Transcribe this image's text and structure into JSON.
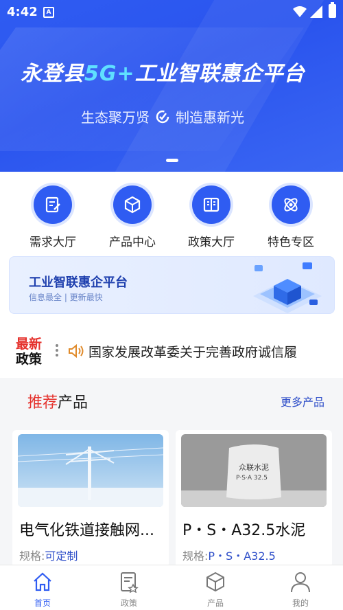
{
  "status": {
    "time": "4:42",
    "app_badge": "A"
  },
  "banner": {
    "title_pre": "永登县",
    "title_hl": "5G+",
    "title_post": "工业智联惠企平台",
    "subtitle_left": "生态聚万贤",
    "subtitle_right": "制造惠新光"
  },
  "grid": [
    {
      "label": "需求大厅",
      "icon": "edit-doc-icon"
    },
    {
      "label": "产品中心",
      "icon": "cube-icon"
    },
    {
      "label": "政策大厅",
      "icon": "book-icon"
    },
    {
      "label": "特色专区",
      "icon": "atom-icon"
    }
  ],
  "promo": {
    "title": "工业智联惠企平台",
    "subtitle": "信息最全 | 更新最快"
  },
  "news": {
    "badge_top": "最新",
    "badge_bottom": "政策",
    "text": "国家发展改革委关于完善政府诚信履"
  },
  "section": {
    "title_red": "推荐",
    "title_rest": "产品",
    "more": "更多产品"
  },
  "products": [
    {
      "name": "电气化铁道接触网...",
      "spec_label": "规格:",
      "spec_value": "可定制"
    },
    {
      "name": "P・S・A32.5水泥",
      "spec_label": "规格:",
      "spec_value": "P・S・A32.5",
      "bag_text1": "众联水泥",
      "bag_text2": "P·S·A 32.5"
    }
  ],
  "tabs": [
    {
      "label": "首页"
    },
    {
      "label": "政策"
    },
    {
      "label": "产品"
    },
    {
      "label": "我的"
    }
  ],
  "colors": {
    "brand": "#2f5cf2",
    "accent_red": "#e5322d",
    "link": "#2f4fc9"
  }
}
